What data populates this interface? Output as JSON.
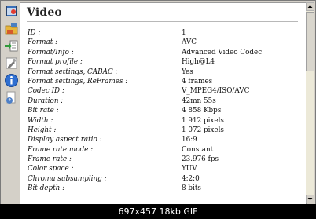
{
  "section_title": "Video",
  "rows": [
    {
      "key": "ID :",
      "value": "1"
    },
    {
      "key": "Format :",
      "value": "AVC"
    },
    {
      "key": "Format/Info :",
      "value": "Advanced Video Codec"
    },
    {
      "key": "Format profile :",
      "value": "High@L4"
    },
    {
      "key": "Format settings, CABAC :",
      "value": "Yes"
    },
    {
      "key": "Format settings, ReFrames :",
      "value": "4 frames"
    },
    {
      "key": "Codec ID :",
      "value": "V_MPEG4/ISO/AVC"
    },
    {
      "key": "Duration :",
      "value": "42mn 55s"
    },
    {
      "key": "Bit rate :",
      "value": "4 858 Kbps"
    },
    {
      "key": "Width :",
      "value": "1 912 pixels"
    },
    {
      "key": "Height :",
      "value": "1 072 pixels"
    },
    {
      "key": "Display aspect ratio :",
      "value": "16:9"
    },
    {
      "key": "Frame rate mode :",
      "value": "Constant"
    },
    {
      "key": "Frame rate :",
      "value": "23.976 fps"
    },
    {
      "key": "Color space :",
      "value": "YUV"
    },
    {
      "key": "Chroma subsampling :",
      "value": "4:2:0"
    },
    {
      "key": "Bit depth :",
      "value": "8 bits"
    }
  ],
  "toolbar_icons": [
    "film-icon",
    "open-folder-icon",
    "export-icon",
    "preferences-icon",
    "info-icon",
    "help-icon"
  ],
  "image_caption": "697x457  18kb  GIF"
}
